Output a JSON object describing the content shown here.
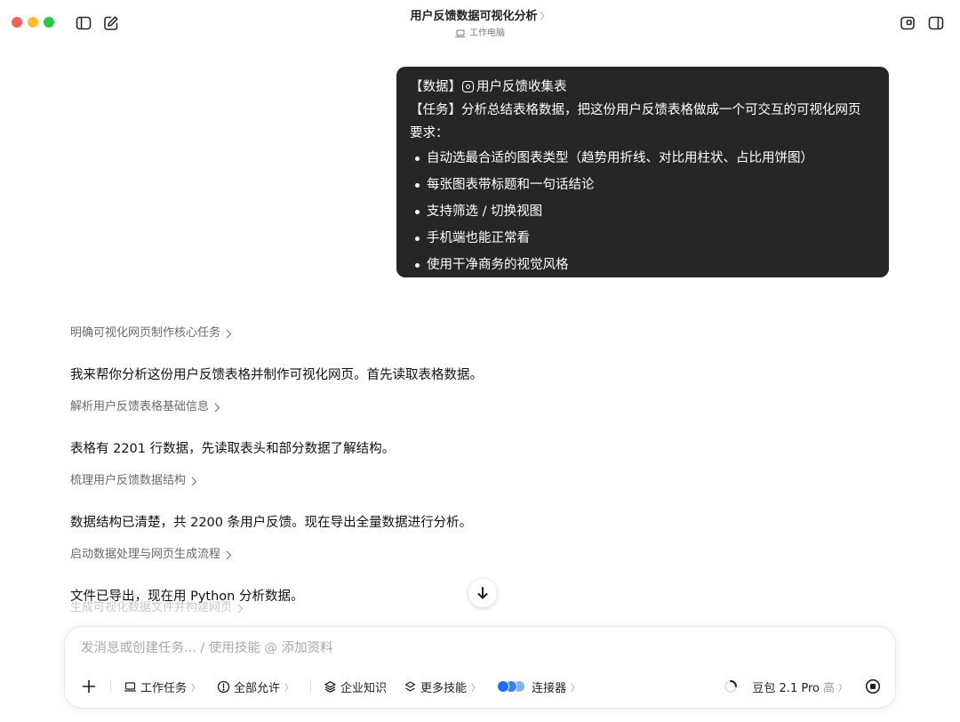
{
  "window": {
    "title": "用户反馈数据可视化分析",
    "title_chevron": "〉",
    "subtitle": "工作电脑"
  },
  "user_message": {
    "data_line": {
      "prefix": "【数据】",
      "attachment": "用户反馈收集表"
    },
    "task_line": "【任务】分析总结表格数据，把这份用户反馈表格做成一个可交互的可视化网页",
    "requirements_label": "要求：",
    "requirements": [
      "自动选最合适的图表类型（趋势用折线、对比用柱状、占比用饼图）",
      "每张图表带标题和一句话结论",
      "支持筛选 / 切换视图",
      "手机端也能正常看",
      "使用干净商务的视觉风格"
    ]
  },
  "assistant": {
    "steps": [
      {
        "title": "明确可视化网页制作核心任务",
        "text": "我来帮你分析这份用户反馈表格并制作可视化网页。首先读取表格数据。"
      },
      {
        "title": "解析用户反馈表格基础信息",
        "text": "表格有 2201 行数据，先读取表头和部分数据了解结构。"
      },
      {
        "title": "梳理用户反馈数据结构",
        "text": "数据结构已清楚，共 2200 条用户反馈。现在导出全量数据进行分析。"
      },
      {
        "title": "启动数据处理与网页生成流程",
        "text": "文件已导出，现在用 Python 分析数据。"
      }
    ],
    "fading_step": "生成可视化数据文件并构建网页"
  },
  "composer": {
    "placeholder": "发消息或创建任务... / 使用技能 @ 添加资料",
    "chips": {
      "work_task": "工作任务",
      "allow_all": "全部允许",
      "enterprise_knowledge": "企业知识",
      "more_skills": "更多技能",
      "connector": "连接器"
    },
    "chip_chevron": "〉",
    "model": {
      "name": "豆包 2.1 Pro",
      "effort": "高",
      "chevron": "〉"
    }
  },
  "colors": {
    "bubble_bg": "#262626",
    "traffic_red": "#fe5f57",
    "traffic_yellow": "#febc2e",
    "traffic_green": "#28c840",
    "connector_blue": "#1a6dff"
  },
  "icons": {
    "sidebar_toggle": "sidebar-icon",
    "new_chat": "edit-icon",
    "window_device": "laptop-icon",
    "attachment": "doc-icon",
    "scroll_down": "arrow-down-icon",
    "add": "plus-icon",
    "allow": "alert-circle-icon",
    "knowledge": "layers-icon",
    "stop": "stop-icon",
    "loading": "spinner-icon"
  }
}
